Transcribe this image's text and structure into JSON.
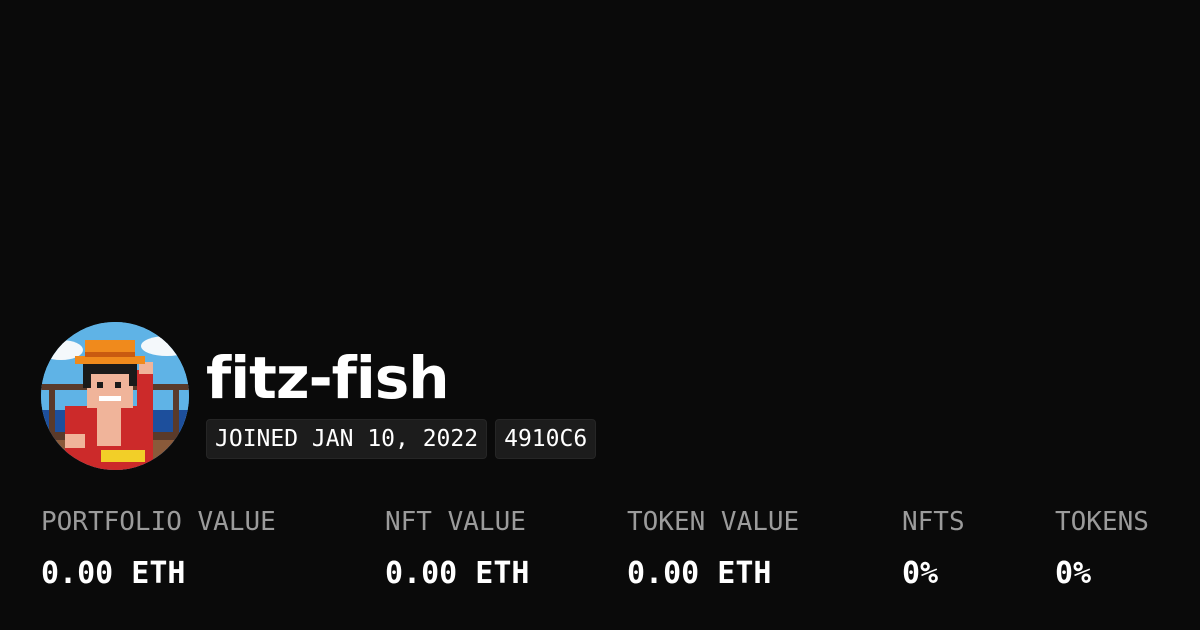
{
  "profile": {
    "username": "fitz-fish",
    "joined": "JOINED JAN 10, 2022",
    "address_tag": "4910C6",
    "avatar_icon": "pixel-art-avatar"
  },
  "stats": [
    {
      "label": "PORTFOLIO VALUE",
      "value": "0.00 ETH"
    },
    {
      "label": "NFT VALUE",
      "value": "0.00 ETH"
    },
    {
      "label": "TOKEN VALUE",
      "value": "0.00 ETH"
    },
    {
      "label": "NFTS",
      "value": "0%"
    },
    {
      "label": "TOKENS",
      "value": "0%"
    }
  ],
  "colors": {
    "background": "#0a0a0a",
    "label": "#9b9b9b",
    "value": "#ffffff",
    "badge_bg": "#1c1c1c"
  }
}
